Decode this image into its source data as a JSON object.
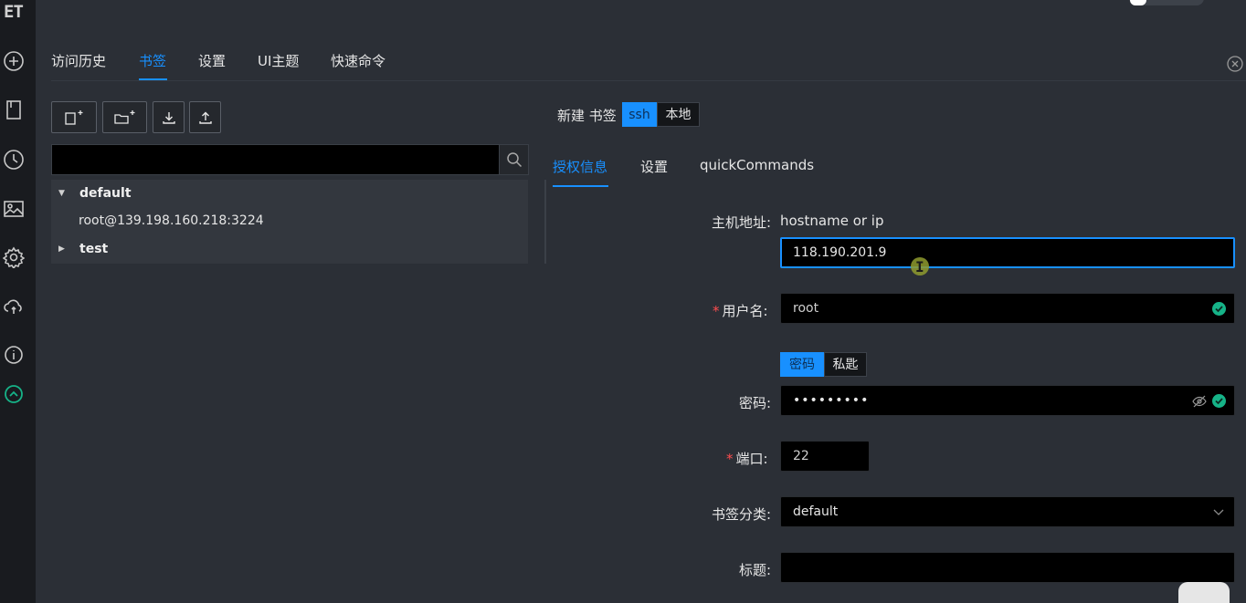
{
  "app": {
    "logo": "ET"
  },
  "main_tabs": [
    {
      "label": "访问历史"
    },
    {
      "label": "书签"
    },
    {
      "label": "设置"
    },
    {
      "label": "UI主题"
    },
    {
      "label": "快速命令"
    }
  ],
  "main_tabs_active": "书签",
  "bookmarks": {
    "search": {
      "value": "",
      "placeholder": ""
    },
    "tree": [
      {
        "label": "default",
        "expanded": true,
        "children": [
          "root@139.198.160.218:3224"
        ]
      },
      {
        "label": "test",
        "expanded": false,
        "children": []
      }
    ]
  },
  "form": {
    "heading": "新建 书签",
    "type_options": [
      "ssh",
      "本地"
    ],
    "type_selected": "ssh",
    "sub_tabs": [
      "授权信息",
      "设置",
      "quickCommands"
    ],
    "sub_tab_active": "授权信息",
    "host": {
      "label": "主机地址:",
      "hint": "hostname or ip",
      "value": "118.190.201.9"
    },
    "username": {
      "required_mark": "*",
      "label": "用户名:",
      "value": "root"
    },
    "auth_options": [
      "密码",
      "私匙"
    ],
    "auth_selected": "密码",
    "password": {
      "label": "密码:",
      "value": "•••••••••"
    },
    "port": {
      "required_mark": "*",
      "label": "端口:",
      "value": "22"
    },
    "category": {
      "label": "书签分类:",
      "value": "default"
    },
    "title": {
      "label": "标题:",
      "value": ""
    }
  },
  "colors": {
    "accent": "#1890ff",
    "success": "#16b388",
    "required": "#ff4d4f"
  }
}
